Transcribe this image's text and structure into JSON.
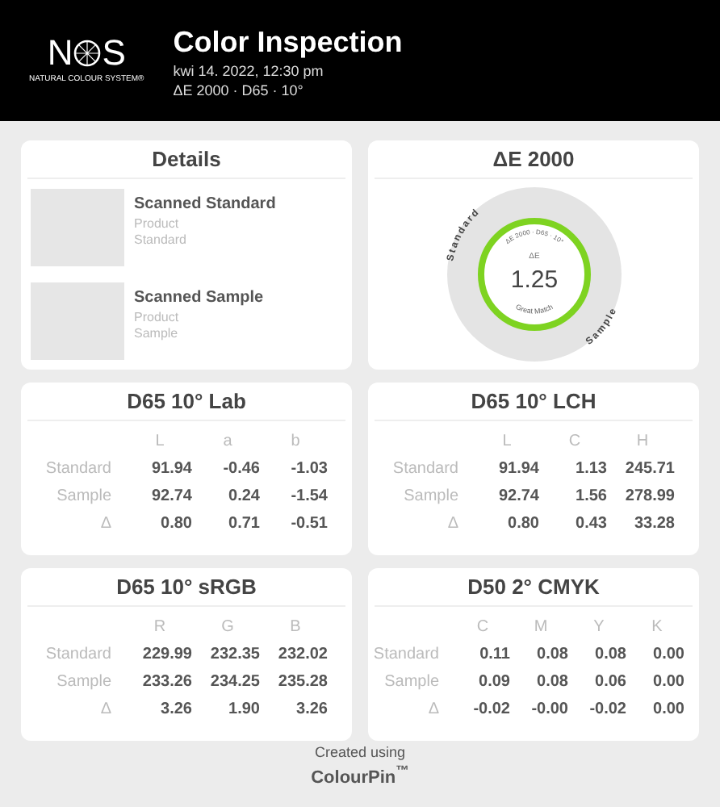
{
  "header": {
    "logo": {
      "letters": [
        "N",
        "S"
      ],
      "tagline": "NATURAL COLOUR SYSTEM®"
    },
    "title": "Color Inspection",
    "date": "kwi 14. 2022, 12:30 pm",
    "subtitle": "ΔE 2000 · D65 · 10°"
  },
  "details": {
    "title": "Details",
    "items": [
      {
        "name": "Scanned Standard",
        "lines": [
          "Product",
          "Standard"
        ]
      },
      {
        "name": "Scanned Sample",
        "lines": [
          "Product",
          "Sample"
        ]
      }
    ]
  },
  "delta_e": {
    "title": "ΔE 2000",
    "outer_top": "Standard",
    "outer_bottom": "Sample",
    "inner_top": "ΔE 2000 · D65 · 10°",
    "label": "ΔE",
    "value": "1.25",
    "verdict": "Great Match"
  },
  "tables": [
    {
      "title": "D65 10° Lab",
      "columns": [
        "L",
        "a",
        "b"
      ],
      "rows": [
        {
          "label": "Standard",
          "values": [
            "91.94",
            "-0.46",
            "-1.03"
          ]
        },
        {
          "label": "Sample",
          "values": [
            "92.74",
            "0.24",
            "-1.54"
          ]
        },
        {
          "label": "Δ",
          "values": [
            "0.80",
            "0.71",
            "-0.51"
          ]
        }
      ]
    },
    {
      "title": "D65 10° LCH",
      "columns": [
        "L",
        "C",
        "H"
      ],
      "rows": [
        {
          "label": "Standard",
          "values": [
            "91.94",
            "1.13",
            "245.71"
          ]
        },
        {
          "label": "Sample",
          "values": [
            "92.74",
            "1.56",
            "278.99"
          ]
        },
        {
          "label": "Δ",
          "values": [
            "0.80",
            "0.43",
            "33.28"
          ]
        }
      ]
    },
    {
      "title": "D65 10° sRGB",
      "columns": [
        "R",
        "G",
        "B"
      ],
      "rows": [
        {
          "label": "Standard",
          "values": [
            "229.99",
            "232.35",
            "232.02"
          ]
        },
        {
          "label": "Sample",
          "values": [
            "233.26",
            "234.25",
            "235.28"
          ]
        },
        {
          "label": "Δ",
          "values": [
            "3.26",
            "1.90",
            "3.26"
          ]
        }
      ]
    },
    {
      "title": "D50 2° CMYK",
      "columns": [
        "C",
        "M",
        "Y",
        "K"
      ],
      "rows": [
        {
          "label": "Standard",
          "values": [
            "0.11",
            "0.08",
            "0.08",
            "0.00"
          ]
        },
        {
          "label": "Sample",
          "values": [
            "0.09",
            "0.08",
            "0.06",
            "0.00"
          ]
        },
        {
          "label": "Δ",
          "values": [
            "-0.02",
            "-0.00",
            "-0.02",
            "0.00"
          ]
        }
      ]
    }
  ],
  "footer": {
    "caption": "Created using",
    "brand": "ColourPin$^{™}$"
  }
}
